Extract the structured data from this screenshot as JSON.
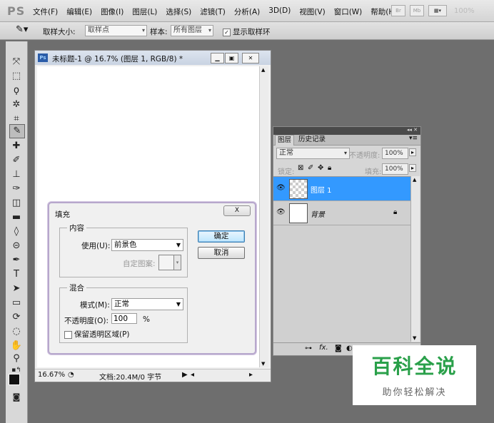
{
  "menubar": {
    "logo": "PS",
    "items": [
      "文件(F)",
      "编辑(E)",
      "图像(I)",
      "图层(L)",
      "选择(S)",
      "滤镜(T)",
      "分析(A)",
      "3D(D)",
      "视图(V)",
      "窗口(W)",
      "帮助(H)"
    ],
    "btn_br": "Br",
    "btn_mb": "Mb",
    "zoom": "100%"
  },
  "options": {
    "sample_size_label": "取样大小:",
    "sample_size_value": "取样点",
    "sample_label": "样本:",
    "sample_value": "所有图层",
    "show_ring_label": "显示取样环"
  },
  "document": {
    "badge": "Ps",
    "title": "未标题-1 @ 16.7% (图层 1, RGB/8) *",
    "zoom": "16.67%",
    "doc_size": "文档:20.4M/0 字节"
  },
  "dialog": {
    "title": "填充",
    "close": "X",
    "content_group": "内容",
    "use_label": "使用(U):",
    "use_value": "前景色",
    "custom_pattern_label": "自定图案:",
    "blend_group": "混合",
    "mode_label": "模式(M):",
    "mode_value": "正常",
    "opacity_label": "不透明度(O):",
    "opacity_value": "100",
    "opacity_unit": "%",
    "preserve_label": "保留透明区域(P)",
    "ok": "确定",
    "cancel": "取消"
  },
  "layers_panel": {
    "tab_layers": "图层",
    "tab_history": "历史记录",
    "blend_mode": "正常",
    "opacity_label": "不透明度:",
    "opacity_value": "100%",
    "lock_label": "锁定:",
    "fill_label": "填充:",
    "fill_value": "100%",
    "layers": [
      {
        "name": "图层 1",
        "selected": true
      },
      {
        "name": "背景",
        "selected": false
      }
    ],
    "footer_fx": "fx."
  },
  "watermark": {
    "title": "百科全说",
    "subtitle": "助你轻松解决"
  },
  "colors": {
    "selection": "#3399ff",
    "watermark_green": "#2aa04a"
  }
}
